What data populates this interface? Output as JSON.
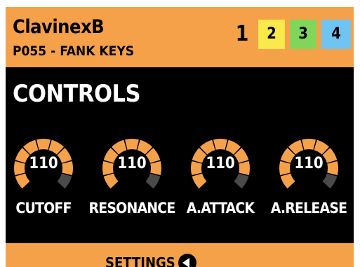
{
  "header": {
    "instrument_name": "ClavinexB",
    "preset_name": "P055 - FANK KEYS",
    "tabs": [
      {
        "label": "1",
        "active": true
      },
      {
        "label": "2",
        "color": "#f9e94a"
      },
      {
        "label": "3",
        "color": "#7fd65b"
      },
      {
        "label": "4",
        "color": "#6fc4f2"
      }
    ]
  },
  "section": {
    "title": "CONTROLS"
  },
  "knobs": [
    {
      "label": "CUTOFF",
      "value": "110",
      "level_fraction": 0.87
    },
    {
      "label": "RESONANCE",
      "value": "110",
      "level_fraction": 0.87
    },
    {
      "label": "A.ATTACK",
      "value": "110",
      "level_fraction": 0.87
    },
    {
      "label": "A.RELEASE",
      "value": "110",
      "level_fraction": 0.87
    }
  ],
  "footer": {
    "settings_label": "SETTINGS",
    "settings_icon": "back-arrow-icon"
  },
  "colors": {
    "accent": "#f5a14a",
    "knob_fill": "#f5a14a",
    "knob_track": "#4a4a4a",
    "background": "#000000"
  }
}
